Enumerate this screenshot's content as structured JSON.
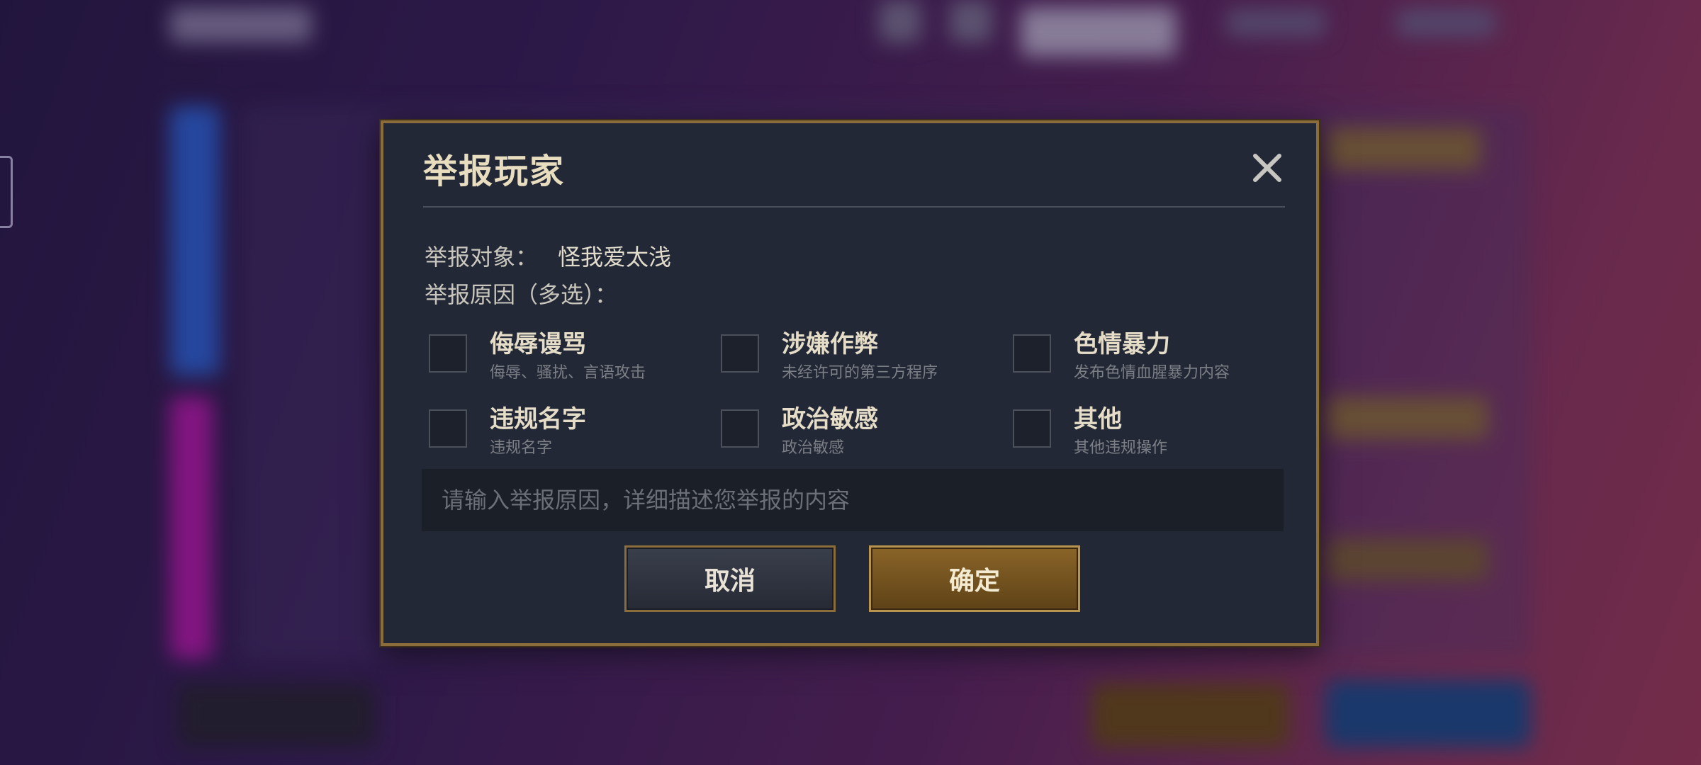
{
  "dialog": {
    "title": "举报玩家",
    "close_icon": "close-icon",
    "target_label": "举报对象：",
    "target_name": "怪我爱太浅",
    "reason_label": "举报原因（多选）：",
    "options": [
      {
        "title": "侮辱谩骂",
        "desc": "侮辱、骚扰、言语攻击",
        "checked": false
      },
      {
        "title": "涉嫌作弊",
        "desc": "未经许可的第三方程序",
        "checked": false
      },
      {
        "title": "色情暴力",
        "desc": "发布色情血腥暴力内容",
        "checked": false
      },
      {
        "title": "违规名字",
        "desc": "违规名字",
        "checked": false
      },
      {
        "title": "政治敏感",
        "desc": "政治敏感",
        "checked": false
      },
      {
        "title": "其他",
        "desc": "其他违规操作",
        "checked": false
      }
    ],
    "input_placeholder": "请输入举报原因，详细描述您举报的内容",
    "input_value": "",
    "cancel_label": "取消",
    "confirm_label": "确定"
  },
  "colors": {
    "accent_gold": "#8a6d3b",
    "dialog_bg": "#222835",
    "confirm_bg": "#7a5622"
  }
}
